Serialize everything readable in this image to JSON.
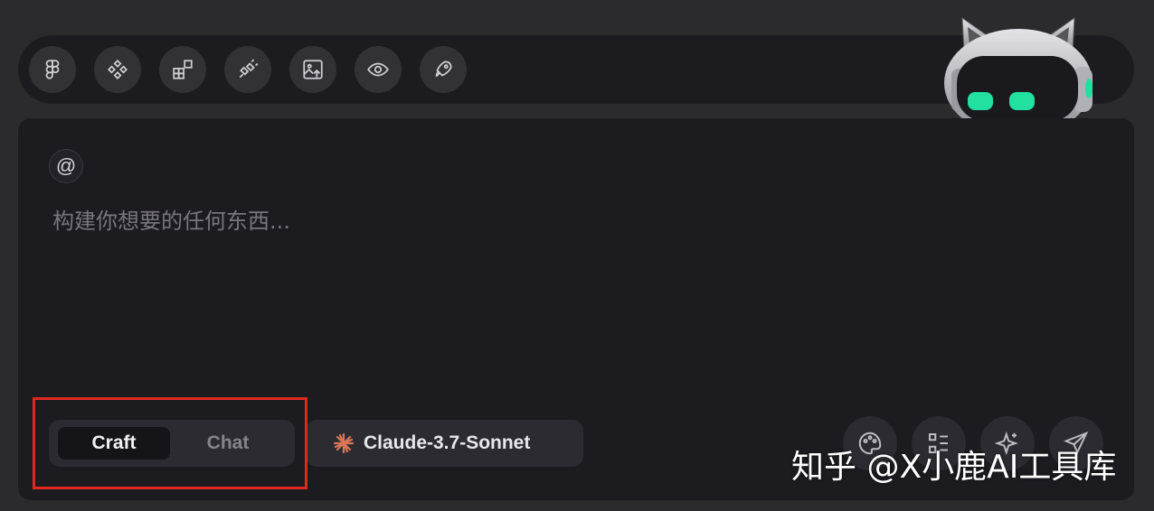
{
  "toolbar": {
    "tools": [
      {
        "icon": "figma-icon"
      },
      {
        "icon": "component-icon"
      },
      {
        "icon": "blocks-icon"
      },
      {
        "icon": "plug-icon"
      },
      {
        "icon": "image-upload-icon"
      },
      {
        "icon": "eye-icon"
      },
      {
        "icon": "rocket-icon"
      }
    ],
    "mascot": "robot-cat-mascot"
  },
  "composer": {
    "mention_symbol": "@",
    "placeholder": "构建你想要的任何东西...",
    "modes": {
      "active": "Craft",
      "inactive": "Chat"
    },
    "model_label": "Claude-3.7-Sonnet",
    "model_icon": "claude-spark-icon",
    "actions": [
      {
        "icon": "palette-icon"
      },
      {
        "icon": "qr-list-icon"
      },
      {
        "icon": "sparkle-icon"
      },
      {
        "icon": "send-icon"
      }
    ]
  },
  "watermark": "知乎 @X小鹿AI工具库",
  "colors": {
    "background": "#2b2b2e",
    "panel": "#1c1b20",
    "highlight": "#e0281e",
    "claude_accent": "#d97757",
    "mascot_eyes": "#22e0a0"
  }
}
